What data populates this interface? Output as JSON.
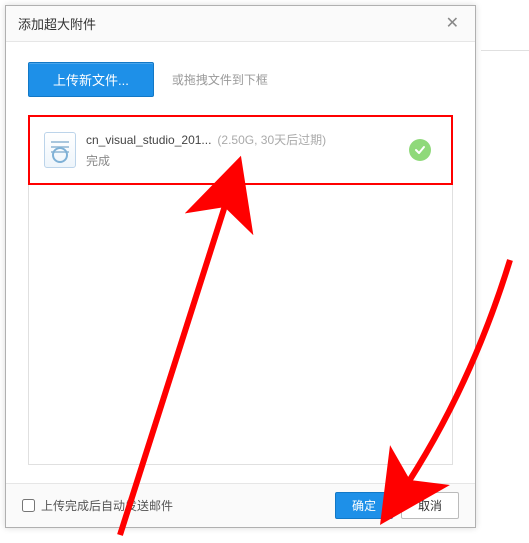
{
  "dialog": {
    "title": "添加超大附件",
    "upload_button": "上传新文件...",
    "drag_hint": "或拖拽文件到下框",
    "file": {
      "name": "cn_visual_studio_201...",
      "meta": "(2.50G, 30天后过期)",
      "status": "完成"
    },
    "footer": {
      "auto_send_label": "上传完成后自动发送邮件",
      "ok": "确定",
      "cancel": "取消"
    }
  }
}
